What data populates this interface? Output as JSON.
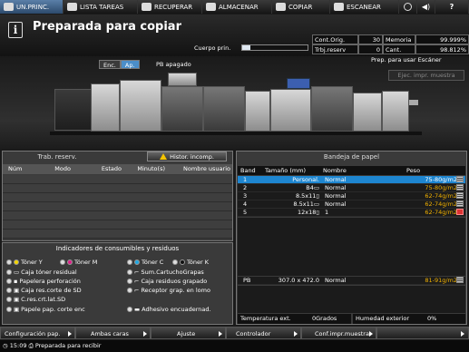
{
  "tabs": [
    {
      "label": "UN.PRINC.",
      "icon": "home-icon",
      "active": true
    },
    {
      "label": "LISTA TAREAS",
      "icon": "list-icon",
      "active": false
    },
    {
      "label": "RECUPERAR",
      "icon": "folder-icon",
      "active": false
    },
    {
      "label": "ALMACENAR",
      "icon": "store-icon",
      "active": false
    },
    {
      "label": "COPIAR",
      "icon": "copy-icon",
      "active": false
    },
    {
      "label": "ESCANEAR",
      "icon": "scan-icon",
      "active": false
    }
  ],
  "header": {
    "title": "Preparada para copiar",
    "cuerpo_label": "Cuerpo prin.",
    "cuerpo_level": 0.12
  },
  "counters": {
    "cont_orig_label": "Cont.Orig.",
    "cont_orig_value": "30",
    "memoria_label": "Memoria",
    "memoria_value": "99.999%",
    "trbj_label": "Trbj.reserv",
    "trbj_value": "0",
    "cant_label": "Cant. arch.",
    "cant_value": "98.812%"
  },
  "machine": {
    "enc_label": "Enc.",
    "ap_label": "Ap.",
    "power_status": "PB apagado",
    "scanner_status": "Prep. para usar Escáner",
    "ej_button": "Ejec. impr. muestra"
  },
  "trab": {
    "title": "Trab. reserv.",
    "hist_button": "Histor. incomp.",
    "columns": [
      "Núm",
      "Modo",
      "Estado",
      "Minuto(s)",
      "Nombre usuario"
    ]
  },
  "indicators": {
    "title": "Indicadores de consumibles y residuos",
    "items": [
      "Tóner Y",
      "Tóner M",
      "Tóner C",
      "Tóner K",
      "Caja tóner residual",
      "Sum.CartuchoGrapas",
      "Papelera perforación",
      "Caja residuos grapado",
      "Caja res.corte de SD",
      "Receptor grap. en lomo",
      "C.res.crt.lat.SD",
      "Papele pap. corte enc",
      "Adhesivo encuadernad."
    ]
  },
  "bandeja": {
    "title": "Bandeja de papel",
    "columns": [
      "Band",
      "Tamaño (mm)",
      "Nombre",
      "Peso"
    ],
    "rows": [
      {
        "band": "1",
        "size": "Personal.",
        "name": "Normal",
        "weight": "75-80g/m2",
        "selected": true
      },
      {
        "band": "2",
        "size": "B4▭",
        "name": "Normal",
        "weight": "75-80g/m2",
        "selected": false
      },
      {
        "band": "3",
        "size": "8.5x11▯",
        "name": "Normal",
        "weight": "62-74g/m2",
        "selected": false
      },
      {
        "band": "4",
        "size": "8.5x11▭",
        "name": "Normal",
        "weight": "62-74g/m2",
        "selected": false
      },
      {
        "band": "5",
        "size": "12x18▯",
        "name": "1",
        "weight": "62-74g/m2",
        "selected": false
      }
    ],
    "pb": {
      "band": "PB",
      "size": "307.0 x 472.0",
      "name": "Normal",
      "weight": "81-91g/m2"
    },
    "temp_label": "Temperatura ext.",
    "temp_value": "0Grados",
    "hum_label": "Humedad exterior",
    "hum_value": "0%"
  },
  "bottom": {
    "buttons": [
      "Configuración pap.",
      "Ambas caras",
      "Ajuste",
      "Controlador",
      "Conf.impr.muestra"
    ]
  },
  "status": {
    "time": "15:09",
    "message": "Preparada para recibir"
  },
  "colors": {
    "accent": "#1e86d0",
    "active_tab": "#4b7bb0"
  }
}
